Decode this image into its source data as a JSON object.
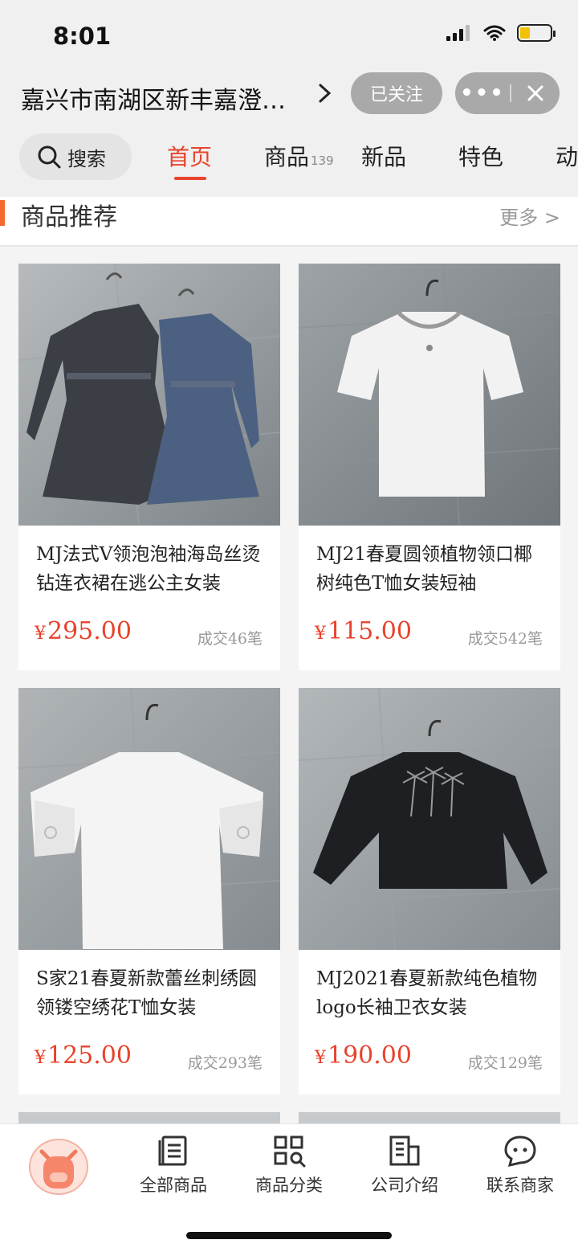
{
  "status_bar": {
    "time": "8:01"
  },
  "header": {
    "shop_title": "嘉兴市南湖区新丰嘉澄…",
    "follow_label": "已关注",
    "capsule_more": "•••"
  },
  "nav": {
    "search_label": "搜索",
    "tabs": [
      {
        "label": "首页"
      },
      {
        "label": "商品",
        "count": "139"
      },
      {
        "label": "新品"
      },
      {
        "label": "特色"
      },
      {
        "label": "动"
      }
    ]
  },
  "section": {
    "title": "商品推荐",
    "more": "更多 >"
  },
  "products": [
    {
      "name": "MJ法式V领泡泡袖海岛丝烫钻连衣裙在逃公主女装",
      "price": "295.00",
      "currency": "¥",
      "deals": "成交46笔"
    },
    {
      "name": "MJ21春夏圆领植物领口椰树纯色T恤女装短袖",
      "price": "115.00",
      "currency": "¥",
      "deals": "成交542笔"
    },
    {
      "name": "S家21春夏新款蕾丝刺绣圆领镂空绣花T恤女装",
      "price": "125.00",
      "currency": "¥",
      "deals": "成交293笔"
    },
    {
      "name": "MJ2021春夏新款纯色植物logo长袖卫衣女装",
      "price": "190.00",
      "currency": "¥",
      "deals": "成交129笔"
    }
  ],
  "tabbar": {
    "items": [
      {
        "label": "全部商品",
        "icon": "list-icon"
      },
      {
        "label": "商品分类",
        "icon": "category-grid-icon"
      },
      {
        "label": "公司介绍",
        "icon": "building-icon"
      },
      {
        "label": "联系商家",
        "icon": "chat-icon"
      }
    ]
  },
  "colors": {
    "accent": "#e8432c",
    "section_bar": "#f36a2d",
    "muted": "#999999"
  }
}
